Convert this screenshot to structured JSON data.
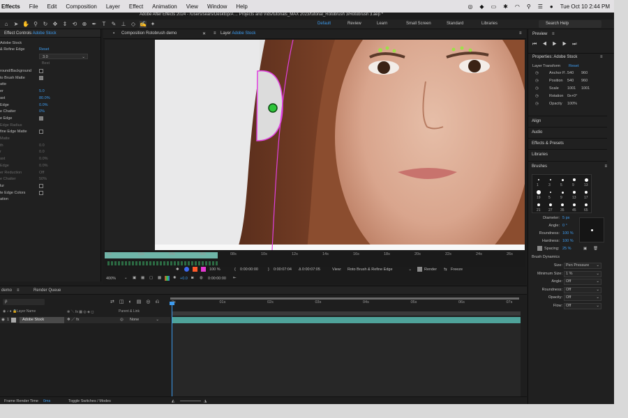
{
  "menubar": {
    "app_name": "Effects",
    "items": [
      "File",
      "Edit",
      "Composition",
      "Layer",
      "Effect",
      "Animation",
      "View",
      "Window",
      "Help"
    ],
    "date_time": "Tue Oct 10  2:44 PM"
  },
  "window_title": "Adobe After Effects 2024 - /Users/sears/Desktop/A ... Projects and Vids/tutorials_MAX 2023/tutorial_Rotobrush 3/Rotobrush 3.aep *",
  "workspaces": [
    "Default",
    "Review",
    "Learn",
    "Small Screen",
    "Standard",
    "Libraries"
  ],
  "active_workspace": "Default",
  "search_help_placeholder": "Search Help",
  "effect_controls": {
    "tab_label": "Effect Controls",
    "tab_layer": "Adobe Stock",
    "layer_name": "Adobe Stock",
    "effect_name": "& Refine Edge",
    "reset": "Reset",
    "version_value": "3.0",
    "quality_value": "Best",
    "rows": [
      {
        "label": "round/Background",
        "value": "",
        "checkbox": true,
        "checked": false
      },
      {
        "label": "to Brush Matte",
        "value": "",
        "checkbox": true,
        "checked": true
      },
      {
        "label": "atte",
        "value": "",
        "checkbox": false,
        "checked": false
      },
      {
        "label": "er",
        "value": "5.0",
        "checkbox": false,
        "checked": false
      },
      {
        "label": "ast",
        "value": "80.0%",
        "checkbox": false,
        "checked": false
      },
      {
        "label": "Edge",
        "value": "0.0%",
        "checkbox": false,
        "checked": false
      },
      {
        "label": "e Chatter",
        "value": "0%",
        "checkbox": false,
        "checked": false
      },
      {
        "label": "e Edge",
        "value": "",
        "checkbox": true,
        "checked": true
      },
      {
        "label": "Edge Radius",
        "value": "",
        "checkbox": false,
        "checked": false
      },
      {
        "label": "fine Edge Matte",
        "value": "",
        "checkbox": true,
        "checked": false
      },
      {
        "label": "Matte",
        "value": "",
        "checkbox": false,
        "checked": false
      },
      {
        "label": "th",
        "value": "0.0",
        "checkbox": false,
        "checked": false
      },
      {
        "label": "r",
        "value": "0.0",
        "checkbox": false,
        "checked": false
      },
      {
        "label": "ast",
        "value": "0.0%",
        "checkbox": false,
        "checked": false
      },
      {
        "label": "Edge",
        "value": "0.0%",
        "checkbox": false,
        "checked": false
      },
      {
        "label": "er Reduction",
        "value": "Off",
        "checkbox": false,
        "checked": false
      },
      {
        "label": "e Chatter",
        "value": "50%",
        "checkbox": false,
        "checked": false
      },
      {
        "label": "lur",
        "value": "",
        "checkbox": true,
        "checked": false
      },
      {
        "label": "te Edge Colors",
        "value": "",
        "checkbox": true,
        "checked": false
      },
      {
        "label": "ation",
        "value": "",
        "checkbox": false,
        "checked": false
      }
    ]
  },
  "viewer": {
    "tab_composition": "Composition Rotobrush demo",
    "tab_layer_prefix": "Layer",
    "tab_layer_name": "Adobe Stock",
    "ruler_labels": [
      "0s",
      "02s",
      "04s",
      "06s",
      "08s",
      "10s",
      "12s",
      "14s",
      "16s",
      "18s",
      "20s",
      "22s",
      "24s",
      "26s"
    ],
    "zoom": "400%",
    "exposure": "+0.0",
    "time_current": "0:00:00:00",
    "time_in": "0:00:00:00",
    "time_out": "0:00:07:04",
    "time_duration": "Δ 0:00:07:05",
    "view_label": "View:",
    "view_value": "Roto Brush & Refine Edge",
    "render_label": "Render",
    "freeze_label": "Freeze",
    "opacity_value": "100 %"
  },
  "right_panel": {
    "preview_label": "Preview",
    "properties_label": "Properties: Adobe Stock",
    "layer_transform_label": "Layer Transform",
    "reset_label": "Reset",
    "properties": [
      {
        "label": "Anchor P..",
        "v1": "540",
        "v2": "960"
      },
      {
        "label": "Position",
        "v1": "540",
        "v2": "960"
      },
      {
        "label": "Scale",
        "v1": "1001",
        "v2": "1001"
      },
      {
        "label": "Rotation",
        "v1": "0x+0°",
        "v2": ""
      },
      {
        "label": "Opacity",
        "v1": "100%",
        "v2": ""
      }
    ],
    "sections": [
      "Align",
      "Audio",
      "Effects & Presets",
      "Libraries"
    ],
    "brushes_label": "Brushes",
    "brush_sizes": [
      "1",
      "3",
      "5",
      "9",
      "13",
      "19",
      "5",
      "9",
      "13",
      "17",
      "21",
      "27",
      "35",
      "45",
      "65"
    ],
    "diameter_label": "Diameter:",
    "diameter_value": "5 px",
    "angle_label": "Angle:",
    "angle_value": "0 °",
    "roundness_label": "Roundness:",
    "roundness_value": "100 %",
    "hardness_label": "Hardness:",
    "hardness_value": "100 %",
    "spacing_label": "Spacing:",
    "spacing_value": "25 %",
    "brush_dynamics_label": "Brush Dynamics",
    "dynamics": [
      {
        "label": "Size:",
        "value": "Pen Pressure"
      },
      {
        "label": "Minimum Size:",
        "value": "1 %"
      },
      {
        "label": "Angle:",
        "value": "Off"
      },
      {
        "label": "Roundness:",
        "value": "Off"
      },
      {
        "label": "Opacity:",
        "value": "Off"
      },
      {
        "label": "Flow:",
        "value": "Off"
      }
    ]
  },
  "timeline": {
    "tab_comp": "demo",
    "tab_render_queue": "Render Queue",
    "search_placeholder": "ρ",
    "col_layer_name": "Layer Name",
    "col_parent": "Parent & Link",
    "layer_number": "1",
    "layer_name": "Adobe Stock",
    "parent_value": "None",
    "ruler_labels": [
      "0s",
      "01s",
      "02s",
      "03s",
      "04s",
      "05s",
      "06s",
      "07s"
    ],
    "footer_render_time_label": "Frame Render Time",
    "footer_render_time_value": "0ms",
    "footer_toggle": "Toggle Switches / Modes"
  },
  "colors": {
    "accent": "#3d9cf0",
    "work_area": "#6fb5a8",
    "layer_bar": "#4fa39a",
    "panel_bg": "#202020"
  }
}
